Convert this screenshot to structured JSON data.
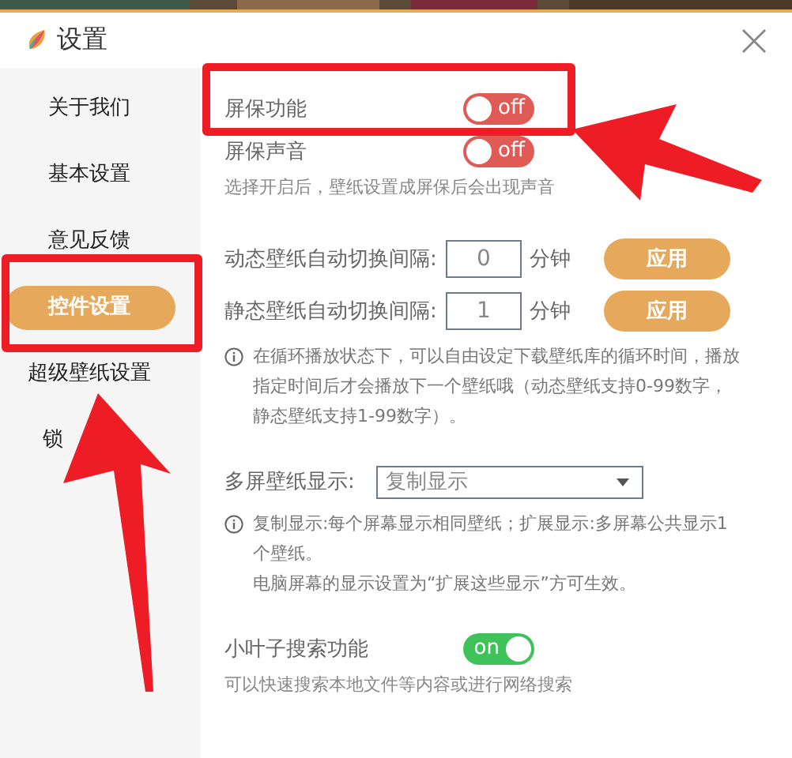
{
  "window": {
    "title": "设置"
  },
  "sidebar": {
    "items": [
      {
        "label": "关于我们",
        "selected": false
      },
      {
        "label": "基本设置",
        "selected": false
      },
      {
        "label": "意见反馈",
        "selected": false
      },
      {
        "label": "控件设置",
        "selected": true
      },
      {
        "label": "超级壁纸设置",
        "selected": false
      },
      {
        "label": "锁",
        "selected": false
      }
    ]
  },
  "settings": [
    {
      "kind": "toggle",
      "label": "屏保功能",
      "on": false,
      "state": "off"
    },
    {
      "kind": "toggle",
      "label": "屏保声音",
      "on": false,
      "state": "off"
    },
    {
      "kind": "note",
      "text": "选择开启后，壁纸设置成屏保后会出现声音"
    },
    {
      "kind": "gap"
    },
    {
      "kind": "interval",
      "label": "动态壁纸自动切换间隔:",
      "value": "0",
      "unit": "分钟",
      "button": "应用"
    },
    {
      "kind": "interval",
      "label": "静态壁纸自动切换间隔:",
      "value": "1",
      "unit": "分钟",
      "button": "应用"
    },
    {
      "kind": "info",
      "lines": [
        "在循环播放状态下，可以自由设定下载壁纸库的循环时间，播放指定时间后才会播放下一个壁纸哦（动态壁纸支持0-99数字，静态壁纸支持1-99数字）。"
      ]
    },
    {
      "kind": "gap"
    },
    {
      "kind": "dropdown",
      "label": "多屏壁纸显示:",
      "value": "复制显示"
    },
    {
      "kind": "info",
      "lines": [
        "复制显示:每个屏幕显示相同壁纸；扩展显示:多屏幕公共显示1个壁纸。",
        "电脑屏幕的显示设置为“扩展这些显示”方可生效。"
      ]
    },
    {
      "kind": "gap"
    },
    {
      "kind": "toggle",
      "label": "小叶子搜索功能",
      "on": true,
      "state": "on"
    },
    {
      "kind": "note",
      "text": "可以快速搜索本地文件等内容或进行网络搜索"
    }
  ]
}
